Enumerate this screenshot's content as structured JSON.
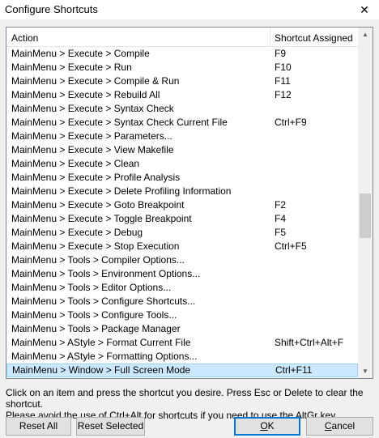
{
  "window": {
    "title": "Configure Shortcuts",
    "close_glyph": "✕"
  },
  "list": {
    "columns": [
      "Action",
      "Shortcut Assigned"
    ],
    "rows": [
      {
        "action": "MainMenu > Execute > Compile",
        "shortcut": "F9"
      },
      {
        "action": "MainMenu > Execute > Run",
        "shortcut": "F10"
      },
      {
        "action": "MainMenu > Execute > Compile & Run",
        "shortcut": "F11"
      },
      {
        "action": "MainMenu > Execute > Rebuild All",
        "shortcut": "F12"
      },
      {
        "action": "MainMenu > Execute > Syntax Check",
        "shortcut": ""
      },
      {
        "action": "MainMenu > Execute > Syntax Check Current File",
        "shortcut": "Ctrl+F9"
      },
      {
        "action": "MainMenu > Execute > Parameters...",
        "shortcut": ""
      },
      {
        "action": "MainMenu > Execute > View Makefile",
        "shortcut": ""
      },
      {
        "action": "MainMenu > Execute > Clean",
        "shortcut": ""
      },
      {
        "action": "MainMenu > Execute > Profile Analysis",
        "shortcut": ""
      },
      {
        "action": "MainMenu > Execute > Delete Profiling Information",
        "shortcut": ""
      },
      {
        "action": "MainMenu > Execute > Goto Breakpoint",
        "shortcut": "F2"
      },
      {
        "action": "MainMenu > Execute > Toggle Breakpoint",
        "shortcut": "F4"
      },
      {
        "action": "MainMenu > Execute > Debug",
        "shortcut": "F5"
      },
      {
        "action": "MainMenu > Execute > Stop Execution",
        "shortcut": "Ctrl+F5"
      },
      {
        "action": "MainMenu > Tools > Compiler Options...",
        "shortcut": ""
      },
      {
        "action": "MainMenu > Tools > Environment Options...",
        "shortcut": ""
      },
      {
        "action": "MainMenu > Tools > Editor Options...",
        "shortcut": ""
      },
      {
        "action": "MainMenu > Tools > Configure Shortcuts...",
        "shortcut": ""
      },
      {
        "action": "MainMenu > Tools > Configure Tools...",
        "shortcut": ""
      },
      {
        "action": "MainMenu > Tools > Package Manager",
        "shortcut": ""
      },
      {
        "action": "MainMenu > AStyle > Format Current File",
        "shortcut": "Shift+Ctrl+Alt+F"
      },
      {
        "action": "MainMenu > AStyle > Formatting Options...",
        "shortcut": ""
      },
      {
        "action": "MainMenu > Window > Full Screen Mode",
        "shortcut": "Ctrl+F11",
        "selected": true
      }
    ],
    "scroll": {
      "thumb_start": 0.47,
      "thumb_size": 0.14
    }
  },
  "help": {
    "line1": "Click on an item and press the shortcut you desire. Press Esc or Delete to clear the shortcut.",
    "line2": "Please avoid the use of Ctrl+Alt for shortcuts if you need to use the AltGr key."
  },
  "buttons": {
    "reset_all": "Reset All",
    "reset_selected": "Reset Selected",
    "ok_mnemonic": "O",
    "ok_rest": "K",
    "cancel_mnemonic": "C",
    "cancel_rest": "ancel"
  },
  "icons": {
    "close": "close-icon",
    "scroll_up": "chevron-up-icon",
    "scroll_down": "chevron-down-icon"
  }
}
